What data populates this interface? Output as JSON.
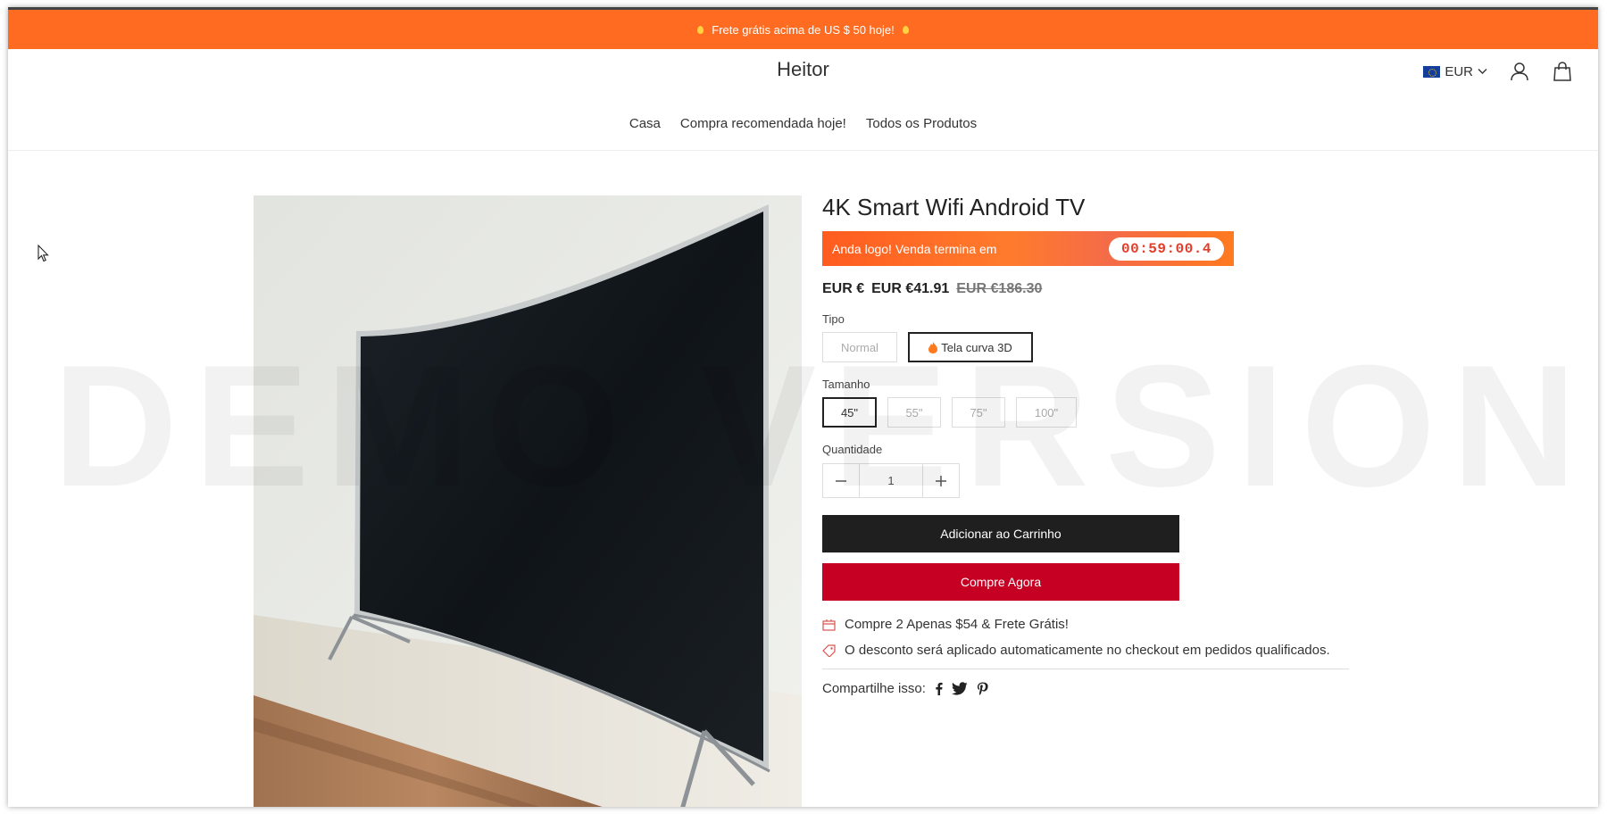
{
  "promo_bar": {
    "text": "Frete grátis acima de US $ 50 hoje!"
  },
  "header": {
    "logo": "Heitor",
    "currency": "EUR",
    "icons": [
      "eu-flag-icon",
      "chevron-down-icon",
      "account-icon",
      "cart-bag-icon"
    ]
  },
  "nav": {
    "items": [
      {
        "label": "Casa"
      },
      {
        "label": "Compra recomendada hoje!"
      },
      {
        "label": "Todos os Produtos"
      }
    ]
  },
  "watermark": "DEMO VERSION",
  "product": {
    "title": "4K Smart Wifi Android TV",
    "sale_banner": {
      "text": "Anda logo! Venda termina em",
      "countdown": "00:59:00.4"
    },
    "price_prefix": "EUR €",
    "price": "EUR €41.91",
    "old_price": "EUR €186.30",
    "type": {
      "label": "Tipo",
      "options": [
        {
          "label": "Normal",
          "selected": false
        },
        {
          "label": "Tela curva 3D",
          "selected": true
        }
      ]
    },
    "size": {
      "label": "Tamanho",
      "options": [
        {
          "label": "45\"",
          "selected": true
        },
        {
          "label": "55\"",
          "selected": false
        },
        {
          "label": "75\"",
          "selected": false
        },
        {
          "label": "100\"",
          "selected": false
        }
      ]
    },
    "quantity": {
      "label": "Quantidade",
      "value": "1"
    },
    "add_to_cart": "Adicionar ao Carrinho",
    "buy_now": "Compre Agora",
    "benefits": [
      {
        "icon": "gift-box-icon",
        "text": "Compre 2 Apenas $54 & Frete Grátis!"
      },
      {
        "icon": "price-tag-icon",
        "text": "O desconto será aplicado automaticamente no checkout em pedidos qualificados."
      }
    ],
    "share_label": "Compartilhe isso:",
    "share_icons": [
      "facebook-icon",
      "twitter-icon",
      "pinterest-icon"
    ]
  },
  "colors": {
    "promo": "#ff6c21",
    "buy_now": "#c60023",
    "add_to_cart": "#1f1f1f",
    "countdown_text": "#e23c2a"
  }
}
